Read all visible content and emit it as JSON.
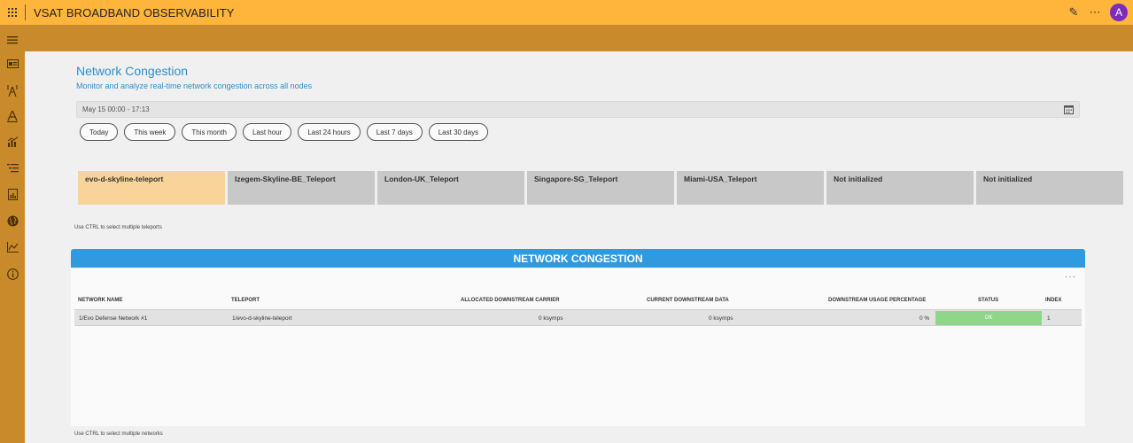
{
  "app": {
    "title": "VSAT BROADBAND OBSERVABILITY",
    "avatar_initial": "A"
  },
  "page": {
    "title": "Network Congestion",
    "subtitle": "Monitor and analyze real-time network congestion across all nodes"
  },
  "date_range": {
    "value": "May 15 00:00 - 17:13"
  },
  "quick_ranges": [
    "Today",
    "This week",
    "This month",
    "Last hour",
    "Last 24 hours",
    "Last 7 days",
    "Last 30 days"
  ],
  "teleports": [
    {
      "label": "evo-d-skyline-teleport",
      "selected": true
    },
    {
      "label": "Izegem-Skyline-BE_Teleport",
      "selected": false
    },
    {
      "label": "London-UK_Teleport",
      "selected": false
    },
    {
      "label": "Singapore-SG_Teleport",
      "selected": false
    },
    {
      "label": "Miami-USA_Teleport",
      "selected": false
    },
    {
      "label": "Not initialized",
      "selected": false
    },
    {
      "label": "Not initialized",
      "selected": false
    }
  ],
  "teleport_hint": "Use CTRL to select multiple teleports",
  "panel": {
    "title": "NETWORK CONGESTION",
    "menu": "···",
    "columns": {
      "network_name": "NETWORK NAME",
      "teleport": "TELEPORT",
      "allocated": "ALLOCATED DOWNSTREAM CARRIER",
      "current": "CURRENT DOWNSTREAM DATA",
      "usage": "DOWNSTREAM USAGE PERCENTAGE",
      "status": "STATUS",
      "index": "INDEX"
    },
    "rows": [
      {
        "network_name": "1/Evo Defense Network #1",
        "teleport": "1/evo-d-skyline-teleport",
        "allocated": "0 ksymps",
        "current": "0 ksymps",
        "usage": "0 %",
        "status": "OK",
        "index": "1"
      }
    ]
  },
  "network_hint": "Use CTRL to select multiple networks",
  "colors": {
    "topbar": "#ffb43c",
    "sidebar": "#c88a2a",
    "accent": "#2f9ae0",
    "selected_card": "#f8d49a",
    "status_ok": "#8fd68a",
    "avatar": "#7b2cbf"
  }
}
